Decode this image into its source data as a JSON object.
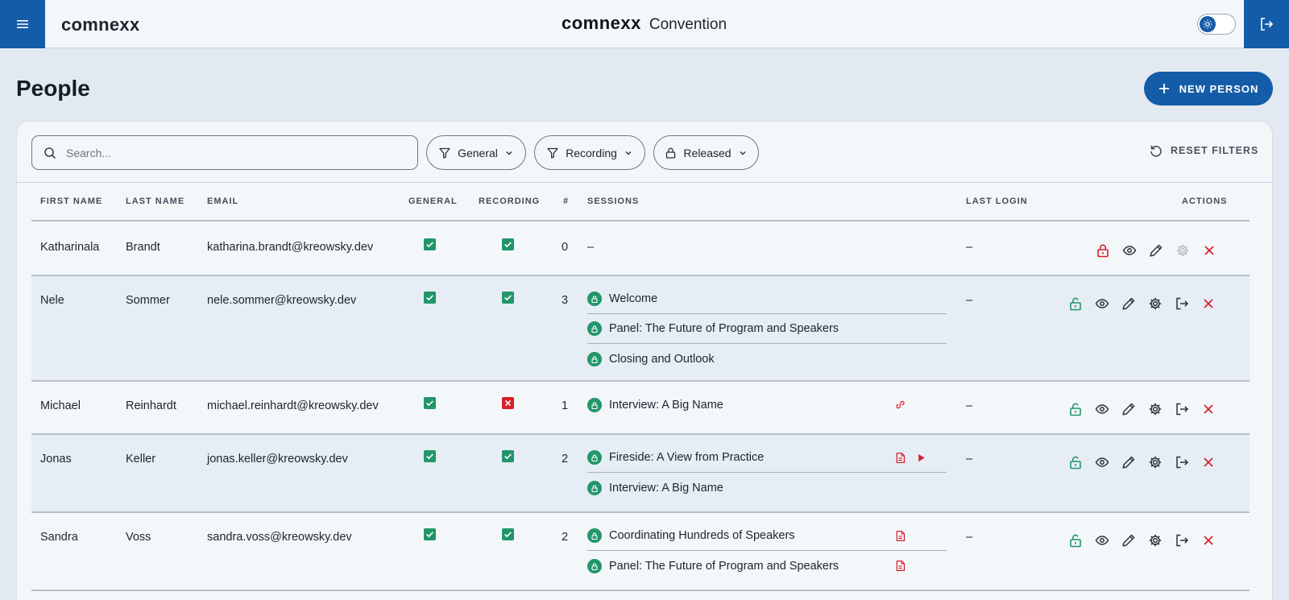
{
  "app": {
    "brand_left": "comnexx",
    "brand_logo": "comnexx",
    "brand_title": "Convention",
    "menu_icon": "hamburger-icon",
    "logout_icon": "logout-icon",
    "theme_icon": "sun-icon"
  },
  "page": {
    "title": "People",
    "new_button": "NEW PERSON"
  },
  "filters": {
    "search_placeholder": "Search...",
    "general": "General",
    "recording": "Recording",
    "released": "Released",
    "reset": "RESET FILTERS"
  },
  "table": {
    "headers": {
      "first_name": "FIRST NAME",
      "last_name": "LAST NAME",
      "email": "EMAIL",
      "general": "GENERAL",
      "recording": "RECORDING",
      "count": "#",
      "sessions": "SESSIONS",
      "last_login": "LAST LOGIN",
      "actions": "ACTIONS"
    },
    "rows": [
      {
        "first": "Katharinala",
        "last": "Brandt",
        "email": "katharina.brandt@kreowsky.dev",
        "general": true,
        "recording": true,
        "count": "0",
        "no_sessions": "–",
        "last_login": "–",
        "released": false,
        "sessions": []
      },
      {
        "first": "Nele",
        "last": "Sommer",
        "email": "nele.sommer@kreowsky.dev",
        "general": true,
        "recording": true,
        "count": "3",
        "last_login": "–",
        "released": true,
        "sessions": [
          {
            "label": "Welcome",
            "icons": []
          },
          {
            "label": "Panel: The Future of Program and Speakers",
            "icons": []
          },
          {
            "label": "Closing and Outlook",
            "icons": []
          }
        ]
      },
      {
        "first": "Michael",
        "last": "Reinhardt",
        "email": "michael.reinhardt@kreowsky.dev",
        "general": true,
        "recording": false,
        "count": "1",
        "last_login": "–",
        "released": true,
        "sessions": [
          {
            "label": "Interview: A Big Name",
            "icons": [
              "link-icon"
            ]
          }
        ]
      },
      {
        "first": "Jonas",
        "last": "Keller",
        "email": "jonas.keller@kreowsky.dev",
        "general": true,
        "recording": true,
        "count": "2",
        "last_login": "–",
        "released": true,
        "sessions": [
          {
            "label": "Fireside: A View from Practice",
            "icons": [
              "document-icon",
              "play-icon"
            ]
          },
          {
            "label": "Interview: A Big Name",
            "icons": []
          }
        ]
      },
      {
        "first": "Sandra",
        "last": "Voss",
        "email": "sandra.voss@kreowsky.dev",
        "general": true,
        "recording": true,
        "count": "2",
        "last_login": "–",
        "released": true,
        "sessions": [
          {
            "label": "Coordinating Hundreds of Speakers",
            "icons": [
              "document-icon"
            ]
          },
          {
            "label": "Panel: The Future of Program and Speakers",
            "icons": [
              "document-icon"
            ]
          }
        ]
      }
    ]
  },
  "colors": {
    "primary": "#155ca8",
    "success": "#22966a",
    "danger": "#d81f2c",
    "background": "#e3e9f1",
    "card": "#f4f7fa"
  }
}
